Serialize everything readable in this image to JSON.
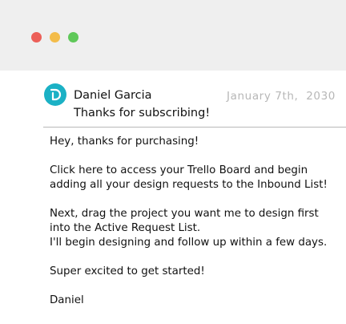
{
  "window": {
    "controls": [
      {
        "name": "close",
        "color": "#ec5f58"
      },
      {
        "name": "minimize",
        "color": "#f3bc4a"
      },
      {
        "name": "maximize",
        "color": "#5fc859"
      }
    ]
  },
  "email": {
    "avatar": {
      "icon": "d-logo-icon",
      "color": "#1bb1c5"
    },
    "sender": "Daniel Garcia",
    "subject": "Thanks for subscribing!",
    "date": "January 7th,  2030",
    "body": {
      "greeting": "Hey, thanks for purchasing!",
      "paragraph1": [
        "Click here to access your Trello Board and begin",
        "adding all your design requests to the Inbound List!"
      ],
      "paragraph2": [
        "Next, drag the project you want me to design first",
        "into the Active Request List.",
        "I'll begin designing and follow up within a few days."
      ],
      "closing": "Super excited to get started!",
      "signature": "Daniel"
    }
  }
}
